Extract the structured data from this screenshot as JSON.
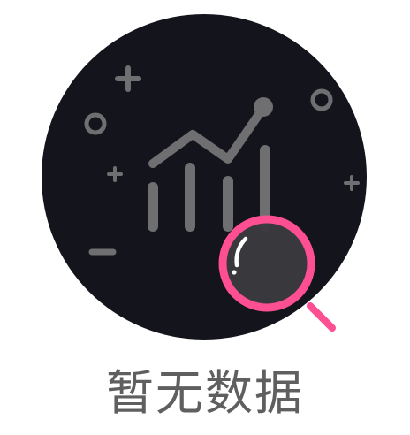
{
  "empty_state": {
    "message": "暂无数据",
    "illustration_icons": [
      "chart-icon",
      "magnifier-icon",
      "plus-icon",
      "minus-icon",
      "circle-icon"
    ]
  },
  "colors": {
    "circle_bg": "#14141c",
    "glyph": "#6f6f72",
    "accent": "#ff4f93",
    "lens": "#3a3a3f",
    "text": "#5f5f5f"
  }
}
